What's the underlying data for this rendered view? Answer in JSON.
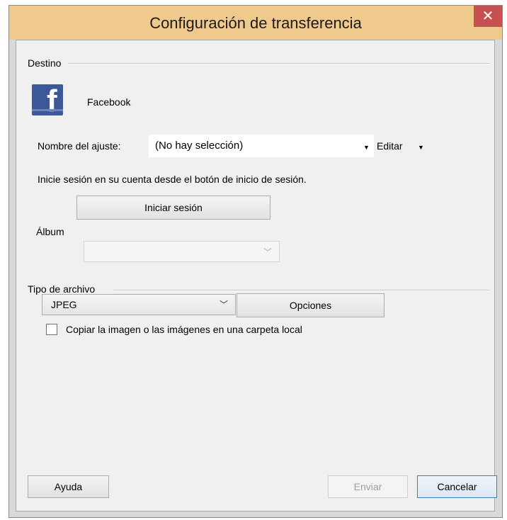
{
  "window": {
    "title": "Configuración de transferencia",
    "close_symbol": "✕"
  },
  "destino": {
    "group_label": "Destino",
    "service_icon": "facebook-icon",
    "service_name": "Facebook",
    "setting_label": "Nombre del ajuste:",
    "setting_value": "(No hay selección)",
    "edit_label": "Editar",
    "login_hint": "Inicie sesión en su cuenta desde el botón de inicio de sesión.",
    "login_button": "Iniciar sesión",
    "album_label": "Álbum",
    "album_value": ""
  },
  "file_type": {
    "group_label": "Tipo de archivo",
    "selected": "JPEG",
    "options_button": "Opciones",
    "copy_checkbox_label": "Copiar la imagen o las imágenes en una carpeta local",
    "copy_checked": false
  },
  "footer": {
    "help_button": "Ayuda",
    "send_button": "Enviar",
    "cancel_button": "Cancelar"
  },
  "colors": {
    "titlebar": "#f0c98d",
    "close_button": "#c75050",
    "facebook_blue": "#3b5998",
    "dialog_background": "#f0f0f0"
  }
}
